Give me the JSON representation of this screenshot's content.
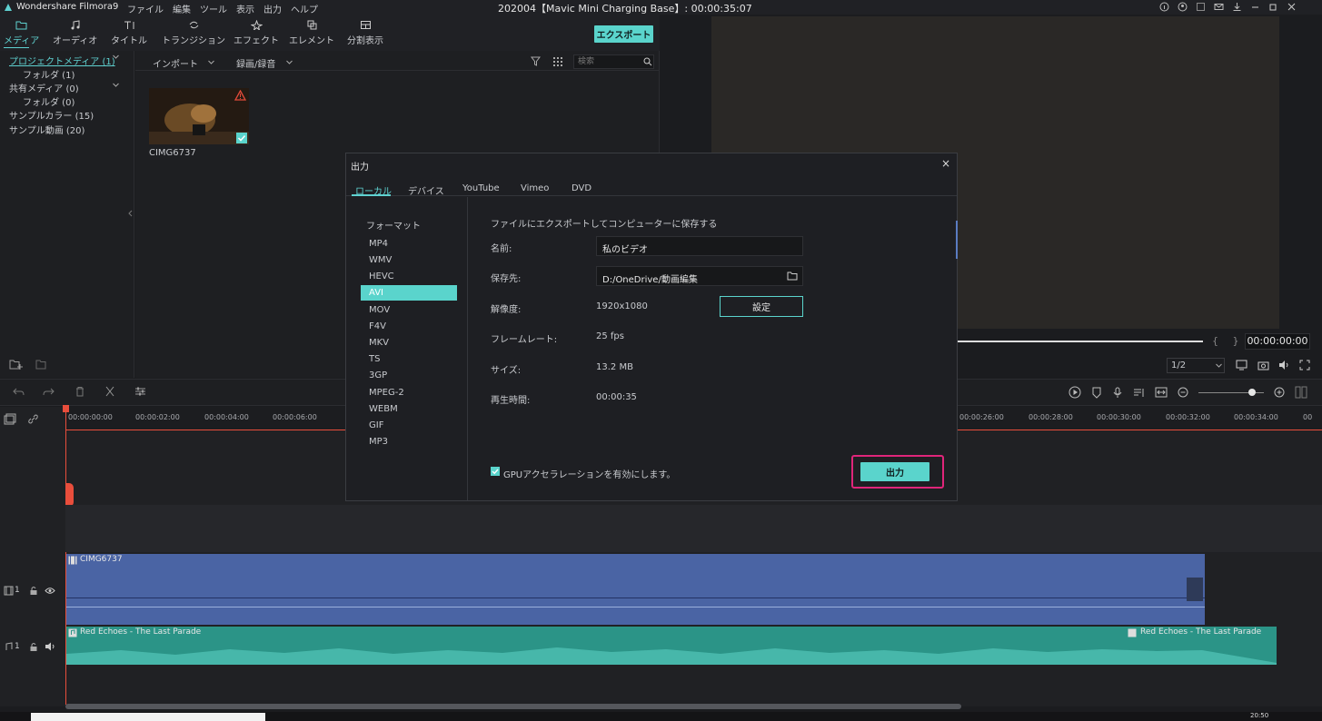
{
  "app": {
    "name": "Wondershare Filmora9",
    "project_title": "202004【Mavic Mini Charging Base】: 00:00:35:07"
  },
  "menu": [
    "ファイル",
    "編集",
    "ツール",
    "表示",
    "出力",
    "ヘルプ"
  ],
  "toolbar": {
    "tabs": [
      {
        "label": "メディア",
        "icon": "folder-icon"
      },
      {
        "label": "オーディオ",
        "icon": "music-note-icon"
      },
      {
        "label": "タイトル",
        "icon": "title-text-icon"
      },
      {
        "label": "トランジション",
        "icon": "transition-icon"
      },
      {
        "label": "エフェクト",
        "icon": "effects-icon"
      },
      {
        "label": "エレメント",
        "icon": "elements-icon"
      },
      {
        "label": "分割表示",
        "icon": "split-screen-icon"
      }
    ],
    "export_label": "エクスポート"
  },
  "media_tree": [
    {
      "label": "プロジェクトメディア (1)",
      "level": 0,
      "selected": true
    },
    {
      "label": "フォルダ (1)",
      "level": 1
    },
    {
      "label": "共有メディア (0)",
      "level": 0
    },
    {
      "label": "フォルダ (0)",
      "level": 1
    },
    {
      "label": "サンプルカラー (15)",
      "level": 0
    },
    {
      "label": "サンプル動画 (20)",
      "level": 0
    }
  ],
  "media_bar": {
    "import_label": "インポート",
    "record_label": "録画/録音",
    "search_placeholder": "検索"
  },
  "media_item": {
    "name": "CIMG6737"
  },
  "preview": {
    "timecode": "00:00:00:00",
    "quality": "1/2",
    "marks": "{ }"
  },
  "export_dialog": {
    "title": "出力",
    "tabs": [
      "ローカル",
      "デバイス",
      "YouTube",
      "Vimeo",
      "DVD"
    ],
    "active_tab": "ローカル",
    "format_header": "フォーマット",
    "formats": [
      "MP4",
      "WMV",
      "HEVC",
      "AVI",
      "MOV",
      "F4V",
      "MKV",
      "TS",
      "3GP",
      "MPEG-2",
      "WEBM",
      "GIF",
      "MP3"
    ],
    "selected_format": "AVI",
    "description": "ファイルにエクスポートしてコンピューターに保存する",
    "name_label": "名前:",
    "name_value": "私のビデオ",
    "save_label": "保存先:",
    "save_value": "D:/OneDrive/動画編集",
    "resolution_label": "解像度:",
    "resolution_value": "1920x1080",
    "settings_label": "設定",
    "framerate_label": "フレームレート:",
    "framerate_value": "25 fps",
    "size_label": "サイズ:",
    "size_value": "13.2 MB",
    "duration_label": "再生時間:",
    "duration_value": "00:00:35",
    "gpu_label": "GPUアクセラレーションを有効にします。",
    "gpu_checked": true,
    "export_button": "出力",
    "close_label": "×"
  },
  "timeline": {
    "ticks_left": [
      "00:00:00:00",
      "00:00:02:00",
      "00:00:04:00",
      "00:00:06:00"
    ],
    "ticks_right": [
      "00:00:26:00",
      "00:00:28:00",
      "00:00:30:00",
      "00:00:32:00",
      "00:00:34:00",
      "00"
    ],
    "video_track_label": "1",
    "audio_track_label": "1",
    "video_clip": "CIMG6737",
    "audio_clip": "Red Echoes - The Last Parade",
    "audio_clip_2": "Red Echoes - The Last Parade"
  },
  "taskbar": {
    "time": "20:50"
  },
  "colors": {
    "accent": "#5ad4cc",
    "highlight": "#e0257a",
    "video_clip": "#4a64a4",
    "audio_clip": "#2b9487",
    "playhead": "#e94e3c"
  }
}
